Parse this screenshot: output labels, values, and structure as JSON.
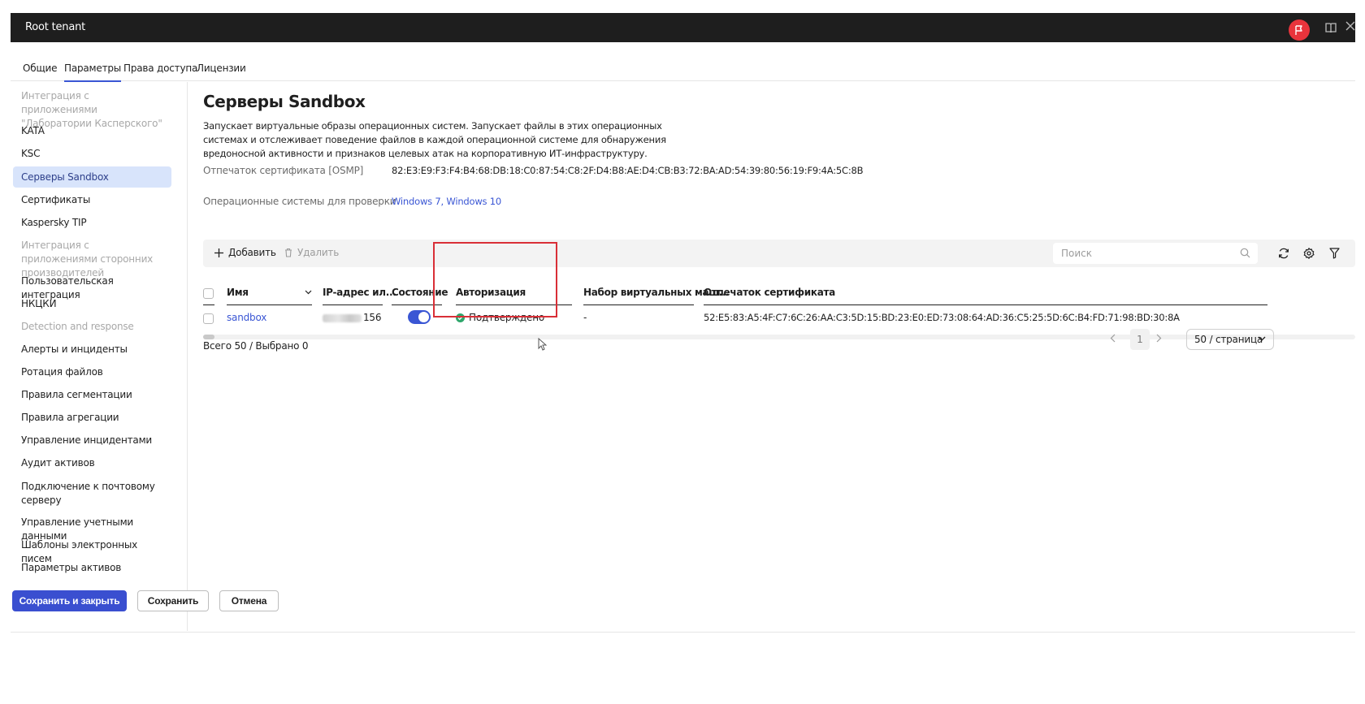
{
  "window": {
    "title": "Root tenant"
  },
  "tabs": [
    {
      "label": "Общие"
    },
    {
      "label": "Параметры"
    },
    {
      "label": "Права доступа"
    },
    {
      "label": "Лицензии"
    }
  ],
  "sidebar": {
    "items": [
      {
        "label": "Интеграция с приложениями \"Лаборатории Касперского\""
      },
      {
        "label": "KATA"
      },
      {
        "label": "KSC"
      },
      {
        "label": "Серверы Sandbox"
      },
      {
        "label": "Сертификаты"
      },
      {
        "label": "Kaspersky TIP"
      },
      {
        "label": "Интеграция с приложениями сторонних производителей"
      },
      {
        "label": "Пользовательская интеграция"
      },
      {
        "label": "НКЦКИ"
      },
      {
        "label": "Detection and response"
      },
      {
        "label": "Алерты и инциденты"
      },
      {
        "label": "Ротация файлов"
      },
      {
        "label": "Правила сегментации"
      },
      {
        "label": "Правила агрегации"
      },
      {
        "label": "Управление инцидентами"
      },
      {
        "label": "Аудит активов"
      },
      {
        "label": "Подключение к почтовому серверу"
      },
      {
        "label": "Управление учетными данными"
      },
      {
        "label": "Шаблоны электронных писем"
      },
      {
        "label": "Параметры активов"
      }
    ]
  },
  "main": {
    "title": "Серверы Sandbox",
    "description": "Запускает виртуальные образы операционных систем. Запускает файлы в этих операционных системах и отслеживает поведение файлов в каждой операционной системе для обнаружения вредоносной активности и признаков целевых атак на корпоративную ИТ-инфраструктуру.",
    "cert_label": "Отпечаток сертификата [OSMP]",
    "cert_value": "82:E3:E9:F3:F4:B4:68:DB:18:C0:87:54:C8:2F:D4:B8:AE:D4:CB:B3:72:BA:AD:54:39:80:56:19:F9:4A:5C:8B",
    "os_label": "Операционные системы для проверки",
    "os_value": "Windows 7, Windows 10"
  },
  "toolbar": {
    "add_label": "Добавить",
    "delete_label": "Удалить",
    "search_placeholder": "Поиск"
  },
  "table": {
    "columns": [
      "Имя",
      "IP-адрес ил...",
      "Состояние",
      "Авторизация",
      "Набор виртуальных маш...",
      "Отпечаток сертификата"
    ],
    "rows": [
      {
        "name": "sandbox",
        "ip_suffix": "156",
        "state_enabled": true,
        "authorization": "Подтверждено",
        "vm_set": "-",
        "cert": "52:E5:83:A5:4F:C7:6C:26:AA:C3:5D:15:BD:23:E0:ED:73:08:64:AD:36:C5:25:5D:6C:B4:FD:71:98:BD:30:8A"
      }
    ]
  },
  "footer": {
    "total": "Всего 50 / Выбрано 0",
    "page": "1",
    "per_page": "50 / страница"
  },
  "buttons": {
    "save_close": "Сохранить и закрыть",
    "save": "Сохранить",
    "cancel": "Отмена"
  },
  "colors": {
    "accent": "#3a56d4",
    "titlebar": "#1e1e1e",
    "highlight": "#d92f37",
    "success": "#2ea66b"
  }
}
